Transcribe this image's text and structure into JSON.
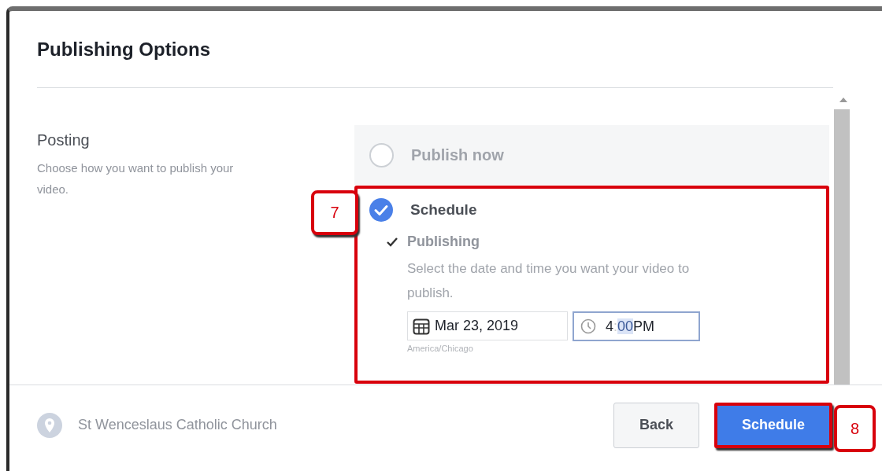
{
  "dialog": {
    "title": "Publishing Options"
  },
  "section": {
    "heading": "Posting",
    "description": "Choose how you want to publish your video."
  },
  "options": [
    {
      "label": "Publish now",
      "selected": false
    },
    {
      "label": "Schedule",
      "selected": true
    }
  ],
  "publishing": {
    "label": "Publishing",
    "checked": true,
    "hint": "Select the date and time you want your video to publish.",
    "date": "Mar 23, 2019",
    "time_hour": "4",
    "time_separator": ":",
    "time_minute": "00",
    "time_period": "PM",
    "timezone": "America/Chicago"
  },
  "footer": {
    "location": "St Wenceslaus Catholic Church",
    "buttons": [
      {
        "label": "Back",
        "kind": "secondary"
      },
      {
        "label": "Schedule",
        "kind": "primary"
      }
    ]
  },
  "annotations": [
    {
      "label": "7"
    },
    {
      "label": "8"
    }
  ]
}
